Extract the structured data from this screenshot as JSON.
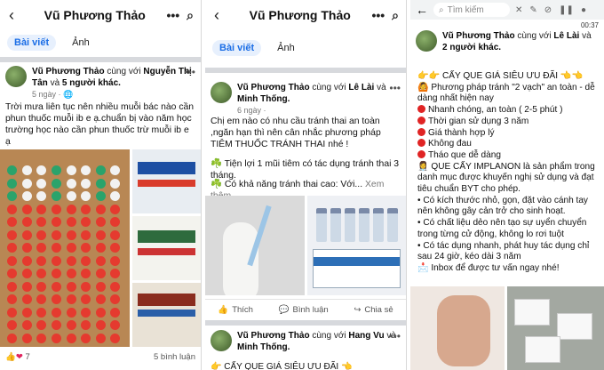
{
  "panel1": {
    "title": "Vũ Phương Thảo",
    "tabs": [
      "Bài viết",
      "Ảnh"
    ],
    "post": {
      "author": "Vũ Phương Thảo",
      "with_text": "cùng với",
      "tagged": "Nguyễn Thị Tân",
      "and_text": "và",
      "others": "5 người khác.",
      "time": "5 ngày ·",
      "text": "Trời mưa liên tục nên nhiều muỗi bác nào cần phun thuốc muỗi ib e ạ.chuẩn bị vào năm học trường học nào cần phun thuốc trừ muỗi ib e ạ",
      "reaction_count": "7",
      "comments": "5 bình luận"
    }
  },
  "panel2": {
    "title": "Vũ Phương Thảo",
    "tabs": [
      "Bài viết",
      "Ảnh"
    ],
    "post1": {
      "author": "Vũ Phương Thảo",
      "with_text": "cùng với",
      "tagged": "Lê Lài",
      "and_text": "và",
      "tagged2": "Minh Thống.",
      "time": "6 ngày ·",
      "text1": "Chị em nào có nhu cầu tránh thai an toàn ,ngăn hạn thì nên cân nhắc phương pháp TIÊM THUỐC TRÁNH THAI nhé !",
      "text2": "☘️ Tiện lợi 1 mũi tiêm có tác dụng tránh thai 3 tháng.",
      "text3": "☘️ Có khả năng tránh thai cao: Với...",
      "see_more": "Xem thêm"
    },
    "actions": [
      "Thích",
      "Bình luận",
      "Chia sẻ"
    ],
    "post2": {
      "author": "Vũ Phương Thảo",
      "with_text": "cùng với",
      "tagged": "Hang Vu",
      "and_text": "và",
      "tagged2": "Minh Thống.",
      "time": "6 ngày ·",
      "text": "👉 CẤY QUE GIÁ SIÊU ƯU ĐÃI 👈"
    }
  },
  "panel3": {
    "search_placeholder": "Tìm kiếm",
    "clock": "00:37",
    "post": {
      "author": "Vũ Phương Thảo",
      "with_text": "cùng với",
      "tagged": "Lê Lài",
      "and_text": "và",
      "others": "2 người khác.",
      "lines": [
        "👉👉 CẤY QUE GIÁ SIÊU ƯU ĐÃI 👈👈",
        "🙆 Phương pháp tránh \"2 vạch\" an toàn - dễ dàng nhất hiện nay",
        "Nhanh chóng, an toàn ( 2-5 phút )",
        "Thời gian sử dụng 3 năm",
        "Giá thành hợp lý",
        "Không đau",
        "Tháo que dễ dàng",
        "👩‍⚕️ QUE CẤY IMPLANON là sản phẩm trong danh mục được khuyến nghị sử dụng và đạt tiêu chuẩn BYT cho phép.",
        "• Có kích thước nhỏ, gọn, đặt vào cánh tay nên không gây cản trở cho sinh hoạt.",
        "• Có chất liệu dẻo nên tạo sự uyển chuyển trong từng cử động, không lo rơi tuột",
        "• Có tác dụng nhanh, phát huy tác dụng chỉ sau 24 giờ, kéo dài 3 năm",
        "📩 Inbox để được tư vấn ngay nhé!"
      ]
    }
  },
  "colors": {
    "accent": "#1b6ee6",
    "divider": "#d7d9dd",
    "red_dot": "#e02424"
  }
}
